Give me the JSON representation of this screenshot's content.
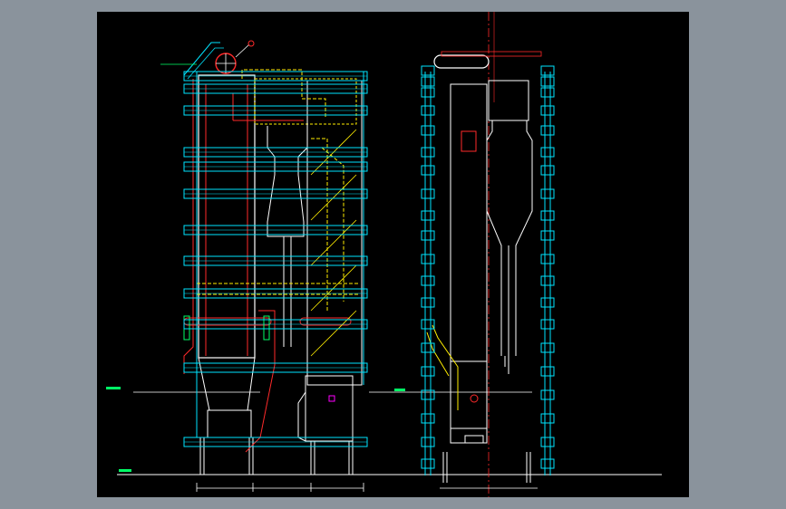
{
  "app": {
    "window_background": "#8a939c",
    "drawing_background": "#000000"
  },
  "drawing": {
    "notes_title": "",
    "notes_rows": [],
    "dimension_labels": [],
    "colors": {
      "structure": "#00e5ff",
      "piping": "#ff2a2a",
      "steam": "#ffee00",
      "outline": "#ffffff",
      "annotation": "#ff00ff",
      "leader": "#00ff66"
    }
  }
}
